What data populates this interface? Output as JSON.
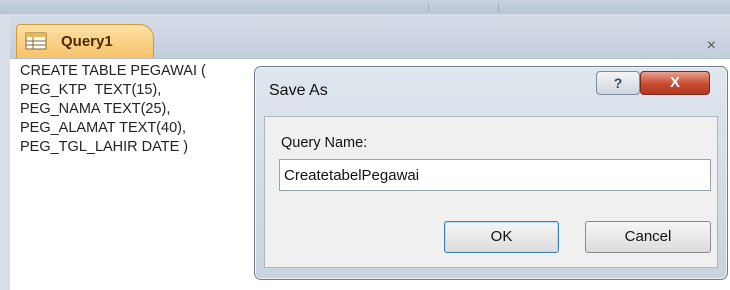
{
  "tab": {
    "title": "Query1",
    "close_glyph": "×",
    "icon": "query-icon"
  },
  "editor": {
    "sql_lines": [
      "CREATE TABLE PEGAWAI (",
      "PEG_KTP  TEXT(15),",
      "PEG_NAMA TEXT(25),",
      "PEG_ALAMAT TEXT(40),",
      "PEG_TGL_LAHIR DATE )"
    ]
  },
  "dialog": {
    "title": "Save As",
    "help_glyph": "?",
    "close_glyph": "X",
    "field_label": "Query Name:",
    "field_value": "CreatetabelPegawai",
    "ok_label": "OK",
    "cancel_label": "Cancel"
  },
  "colors": {
    "tab_orange": "#f7c36a",
    "close_red": "#c74a32",
    "chrome_blue": "#c4cfdc"
  }
}
